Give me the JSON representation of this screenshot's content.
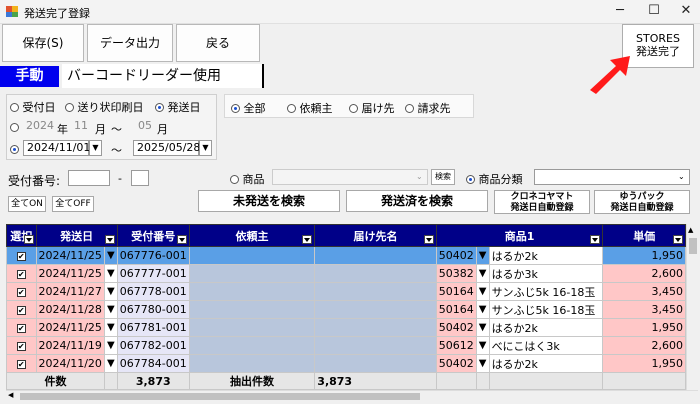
{
  "window": {
    "title": "発送完了登録",
    "minimize": "─",
    "maximize": "☐",
    "close": "✕"
  },
  "toolbar": {
    "save": "保存(S)",
    "export": "データ出力",
    "back": "戻る",
    "stores": "STORES\n発送完了"
  },
  "tabs": {
    "manual": "手動",
    "barcode": "バーコードリーダー使用"
  },
  "date_filter": {
    "opt_received": "受付日",
    "opt_label_printed": "送り状印刷日",
    "opt_shipped": "発送日",
    "selected": "発送日",
    "year_value": "2024",
    "year_unit": "年",
    "month_from": "11",
    "month_unit": "月",
    "tilde": "～",
    "month_to": "05",
    "month_unit2": "月",
    "date_from": "2024/11/01",
    "date_to": "2025/05/28"
  },
  "target_filter": {
    "all": "全部",
    "client": "依頼主",
    "recipient": "届け先",
    "billing": "請求先",
    "selected": "全部"
  },
  "receipt": {
    "label": "受付番号:",
    "from": "",
    "dash": "-",
    "to": ""
  },
  "product_filter": {
    "product": "商品",
    "search": "検索",
    "category": "商品分類",
    "selected": "商品分類",
    "product_value": "",
    "category_value": ""
  },
  "buttons": {
    "all_on": "全てON",
    "all_off": "全てOFF",
    "search_unshipped": "未発送を検索",
    "search_shipped": "発送済を検索",
    "kuroneko_line1": "クロネコヤマト",
    "kuroneko_line2": "発送日自動登録",
    "yupack_line1": "ゆうパック",
    "yupack_line2": "発送日自動登録"
  },
  "table": {
    "headers": [
      "選択",
      "発送日",
      "受付番号",
      "依頼主",
      "届け先名",
      "商品1",
      "単価"
    ],
    "rows": [
      {
        "checked": "✔",
        "date": "2024/11/25",
        "no": "067776-001",
        "code": "50402",
        "product": "はるか2k",
        "price": "1,950"
      },
      {
        "checked": "✔",
        "date": "2024/11/25",
        "no": "067777-001",
        "code": "50382",
        "product": "はるか3k",
        "price": "2,600"
      },
      {
        "checked": "✔",
        "date": "2024/11/27",
        "no": "067778-001",
        "code": "50164",
        "product": "サンふじ5k 16-18玉",
        "price": "3,450"
      },
      {
        "checked": "✔",
        "date": "2024/11/28",
        "no": "067780-001",
        "code": "50164",
        "product": "サンふじ5k 16-18玉",
        "price": "3,450"
      },
      {
        "checked": "✔",
        "date": "2024/11/25",
        "no": "067781-001",
        "code": "50402",
        "product": "はるか2k",
        "price": "1,950"
      },
      {
        "checked": "✔",
        "date": "2024/11/19",
        "no": "067782-001",
        "code": "50612",
        "product": "べにこはく3k",
        "price": "2,600"
      },
      {
        "checked": "✔",
        "date": "2024/11/20",
        "no": "067784-001",
        "code": "50402",
        "product": "はるか2k",
        "price": "1,950"
      }
    ],
    "footer": {
      "count_label": "件数",
      "count": "3,873",
      "extract_label": "抽出件数",
      "extract": "3,873"
    }
  },
  "colors": {
    "header": "#000088",
    "selected_row": "#5a9fe6",
    "pink": "#ffc7c7",
    "tab_manual": "#0000ee",
    "annotation_arrow": "#ff1a1a"
  }
}
